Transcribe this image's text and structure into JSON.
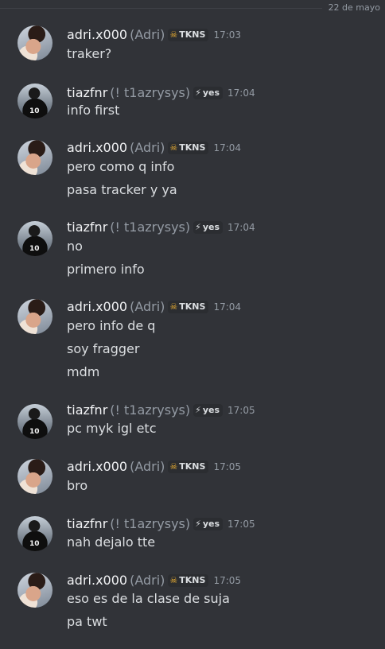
{
  "divider": {
    "date": "22 de mayo"
  },
  "messages": [
    {
      "author": "adri.x000",
      "nick": "(Adri)",
      "tag": "TKNS",
      "tag_icon": "skull-icon",
      "time": "17:03",
      "lines": [
        "traker?"
      ]
    },
    {
      "author": "tiazfnr",
      "nick": "(! t1azrysys)",
      "tag": "yes",
      "tag_icon": "lightning-icon",
      "time": "17:04",
      "lines": [
        "info first"
      ]
    },
    {
      "author": "adri.x000",
      "nick": "(Adri)",
      "tag": "TKNS",
      "tag_icon": "skull-icon",
      "time": "17:04",
      "lines": [
        "pero como q info",
        "pasa tracker y ya"
      ]
    },
    {
      "author": "tiazfnr",
      "nick": "(! t1azrysys)",
      "tag": "yes",
      "tag_icon": "lightning-icon",
      "time": "17:04",
      "lines": [
        "no",
        "primero info"
      ]
    },
    {
      "author": "adri.x000",
      "nick": "(Adri)",
      "tag": "TKNS",
      "tag_icon": "skull-icon",
      "time": "17:04",
      "lines": [
        "pero info de q",
        "soy fragger",
        "mdm"
      ]
    },
    {
      "author": "tiazfnr",
      "nick": "(! t1azrysys)",
      "tag": "yes",
      "tag_icon": "lightning-icon",
      "time": "17:05",
      "lines": [
        "pc myk igl etc"
      ]
    },
    {
      "author": "adri.x000",
      "nick": "(Adri)",
      "tag": "TKNS",
      "tag_icon": "skull-icon",
      "time": "17:05",
      "lines": [
        "bro"
      ]
    },
    {
      "author": "tiazfnr",
      "nick": "(! t1azrysys)",
      "tag": "yes",
      "tag_icon": "lightning-icon",
      "time": "17:05",
      "lines": [
        "nah dejalo tte"
      ]
    },
    {
      "author": "adri.x000",
      "nick": "(Adri)",
      "tag": "TKNS",
      "tag_icon": "skull-icon",
      "time": "17:05",
      "lines": [
        "eso es de la clase de suja",
        "pa twt"
      ]
    }
  ],
  "avatars": {
    "jersey_text": "10"
  }
}
